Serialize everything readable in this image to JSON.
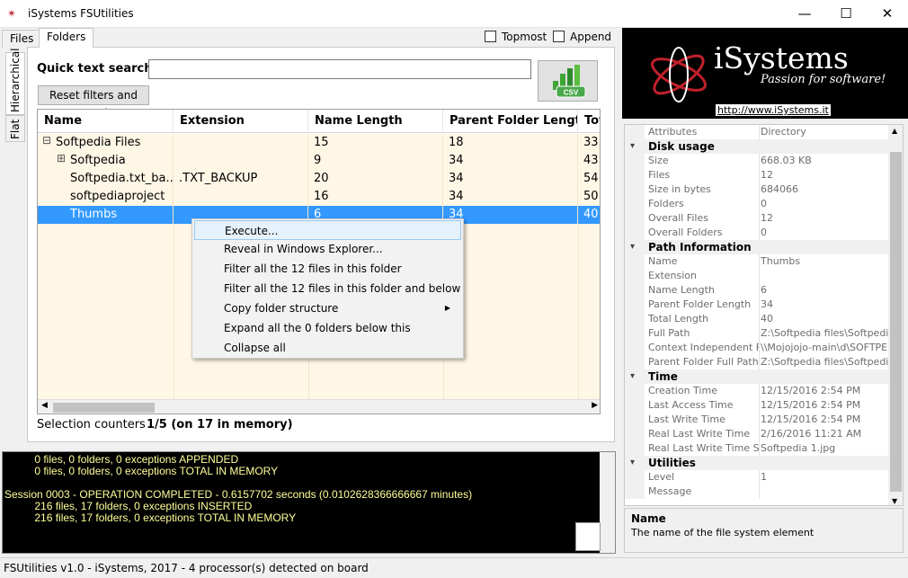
{
  "window": {
    "title": "iSystems FSUtilities",
    "minimize": "—",
    "maximize": "☐",
    "close": "✕"
  },
  "tabs": [
    {
      "label": "Files"
    },
    {
      "label": "Folders"
    }
  ],
  "side_tabs": [
    {
      "label": "Hierarchical"
    },
    {
      "label": "Flat"
    }
  ],
  "options": {
    "topmost": "Topmost",
    "append": "Append"
  },
  "search": {
    "label": "Quick text search",
    "value": "",
    "reset_button": "Reset filters and search",
    "csv_label": "CSV"
  },
  "grid": {
    "columns": [
      "Name",
      "Extension",
      "Name Length",
      "Parent Folder Length",
      "Tot"
    ],
    "rows": [
      {
        "expander": "⊟",
        "name": "Softpedia Files",
        "extension": "",
        "name_length": "15",
        "parent_length": "18",
        "total": "33"
      },
      {
        "expander": "⊞",
        "name": "Softpedia",
        "extension": "",
        "name_length": "9",
        "parent_length": "34",
        "total": "43"
      },
      {
        "expander": "",
        "name": "Softpedia.txt_ba...",
        "extension": ".TXT_BACKUP",
        "name_length": "20",
        "parent_length": "34",
        "total": "54"
      },
      {
        "expander": "",
        "name": "softpediaproject",
        "extension": "",
        "name_length": "16",
        "parent_length": "34",
        "total": "50"
      },
      {
        "expander": "",
        "name": "Thumbs",
        "extension": "",
        "name_length": "6",
        "parent_length": "34",
        "total": "40"
      }
    ],
    "selected_row_index": 4
  },
  "context_menu": {
    "items": [
      "Execute...",
      "Reveal in Windows Explorer...",
      "Filter all the 12 files in this folder",
      "Filter all the 12 files in this folder and below",
      "Copy folder structure",
      "Expand all the 0 folders below this",
      "Collapse all"
    ],
    "submenu_arrow": "▶",
    "highlighted_index": 0
  },
  "selection": {
    "label": "Selection counters",
    "value": "1/5 (on 17 in memory)"
  },
  "log_lines": [
    "          0 files, 0 folders, 0 exceptions APPENDED",
    "          0 files, 0 folders, 0 exceptions TOTAL IN MEMORY",
    "",
    "Session 0003 - OPERATION COMPLETED - 0.6157702 seconds (0.0102628366666667 minutes)",
    "          216 files, 17 folders, 0 exceptions INSERTED",
    "          216 files, 17 folders, 0 exceptions TOTAL IN MEMORY"
  ],
  "status": "FSUtilities v1.0 - iSystems, 2017 - 4 processor(s) detected on board",
  "logo": {
    "brand": "iSystems",
    "tagline": "Passion for software!",
    "url": "http://www.iSystems.it"
  },
  "properties": [
    {
      "type": "prop",
      "key": "Attributes",
      "value": "Directory"
    },
    {
      "type": "cat",
      "key": "Disk usage"
    },
    {
      "type": "prop",
      "key": "Size",
      "value": "668.03 KB"
    },
    {
      "type": "prop",
      "key": "Files",
      "value": "12"
    },
    {
      "type": "prop",
      "key": "Size in bytes",
      "value": "684066"
    },
    {
      "type": "prop",
      "key": "Folders",
      "value": "0"
    },
    {
      "type": "prop",
      "key": "Overall Files",
      "value": "12"
    },
    {
      "type": "prop",
      "key": "Overall Folders",
      "value": "0"
    },
    {
      "type": "cat",
      "key": "Path Information"
    },
    {
      "type": "prop",
      "key": "Name",
      "value": "Thumbs"
    },
    {
      "type": "prop",
      "key": "Extension",
      "value": ""
    },
    {
      "type": "prop",
      "key": "Name Length",
      "value": "6"
    },
    {
      "type": "prop",
      "key": "Parent Folder Length",
      "value": "34"
    },
    {
      "type": "prop",
      "key": "Total Length",
      "value": "40"
    },
    {
      "type": "prop",
      "key": "Full Path",
      "value": "Z:\\Softpedia files\\Softpedia Fi"
    },
    {
      "type": "prop",
      "key": "Context Independent Full",
      "value": "\\\\Mojojojo-main\\d\\SOFTPEDI"
    },
    {
      "type": "prop",
      "key": "Parent Folder Full Path",
      "value": "Z:\\Softpedia files\\Softpedia Fi"
    },
    {
      "type": "cat",
      "key": "Time"
    },
    {
      "type": "prop",
      "key": "Creation Time",
      "value": "12/15/2016 2:54 PM"
    },
    {
      "type": "prop",
      "key": "Last Access Time",
      "value": "12/15/2016 2:54 PM"
    },
    {
      "type": "prop",
      "key": "Last Write Time",
      "value": "12/15/2016 2:54 PM"
    },
    {
      "type": "prop",
      "key": "Real Last Write Time",
      "value": "2/16/2016 11:21 AM"
    },
    {
      "type": "prop",
      "key": "Real Last Write Time Sou",
      "value": "Softpedia 1.jpg"
    },
    {
      "type": "cat",
      "key": "Utilities"
    },
    {
      "type": "prop",
      "key": "Level",
      "value": "1"
    },
    {
      "type": "prop",
      "key": "Message",
      "value": ""
    }
  ],
  "description": {
    "title": "Name",
    "text": "The name of the file system element"
  },
  "colors": {
    "selection": "#3399ff",
    "row_alt": "#fff7e6",
    "log_text": "#ffff99",
    "brand_red": "#c0212c"
  }
}
